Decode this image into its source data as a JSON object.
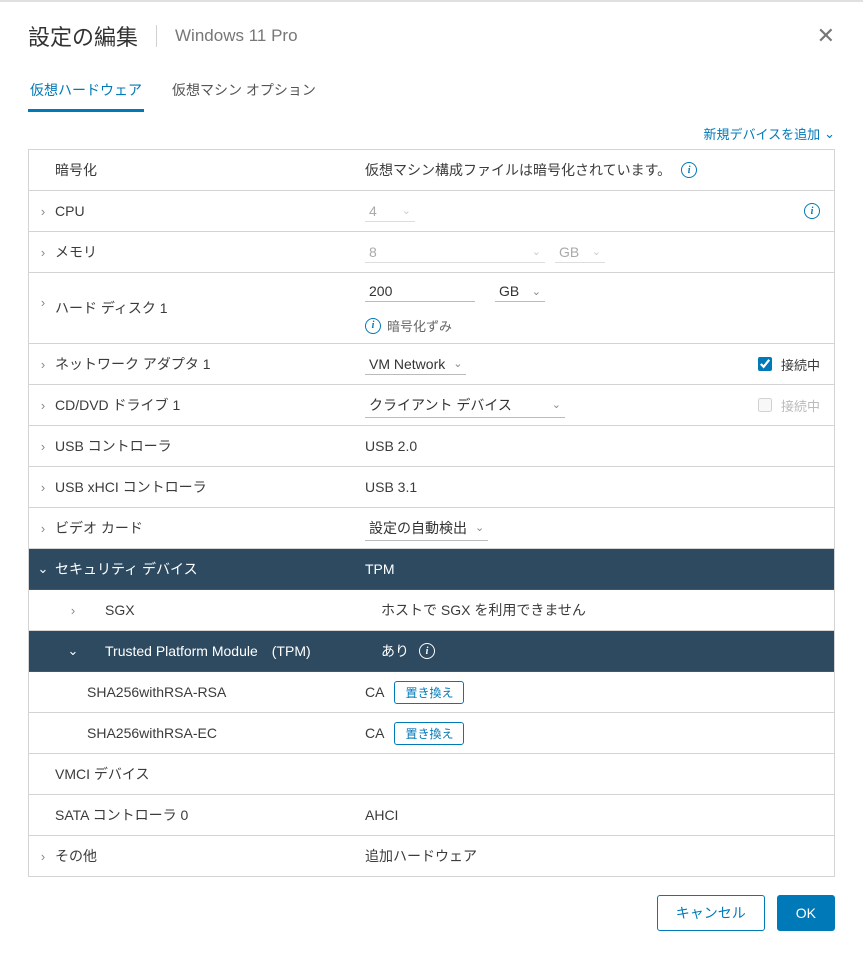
{
  "header": {
    "title": "設定の編集",
    "subtitle": "Windows 11 Pro"
  },
  "tabs": {
    "hardware": "仮想ハードウェア",
    "options": "仮想マシン オプション"
  },
  "toolbar": {
    "add_device": "新規デバイスを追加"
  },
  "rows": {
    "encryption": {
      "label": "暗号化",
      "value": "仮想マシン構成ファイルは暗号化されています。"
    },
    "cpu": {
      "label": "CPU",
      "value": "4"
    },
    "memory": {
      "label": "メモリ",
      "value": "8",
      "unit": "GB"
    },
    "disk": {
      "label": "ハード ディスク 1",
      "value": "200",
      "unit": "GB",
      "encrypted": "暗号化ずみ"
    },
    "network": {
      "label": "ネットワーク アダプタ 1",
      "value": "VM Network",
      "connected": "接続中"
    },
    "cddvd": {
      "label": "CD/DVD ドライブ 1",
      "value": "クライアント デバイス",
      "connected": "接続中"
    },
    "usb": {
      "label": "USB コントローラ",
      "value": "USB 2.0"
    },
    "usbxhci": {
      "label": "USB xHCI コントローラ",
      "value": "USB 3.1"
    },
    "video": {
      "label": "ビデオ カード",
      "value": "設定の自動検出"
    },
    "security": {
      "label": "セキュリティ デバイス",
      "value": "TPM"
    },
    "sgx": {
      "label": "SGX",
      "value": "ホストで SGX を利用できません"
    },
    "tpm": {
      "label": "Trusted Platform Module　(TPM)",
      "value": "あり"
    },
    "sha_rsa": {
      "label": "SHA256withRSA-RSA",
      "value": "CA",
      "btn": "置き換え"
    },
    "sha_ec": {
      "label": "SHA256withRSA-EC",
      "value": "CA",
      "btn": "置き換え"
    },
    "vmci": {
      "label": "VMCI デバイス",
      "value": ""
    },
    "sata": {
      "label": "SATA コントローラ 0",
      "value": "AHCI"
    },
    "other": {
      "label": "その他",
      "value": "追加ハードウェア"
    }
  },
  "footer": {
    "cancel": "キャンセル",
    "ok": "OK"
  }
}
